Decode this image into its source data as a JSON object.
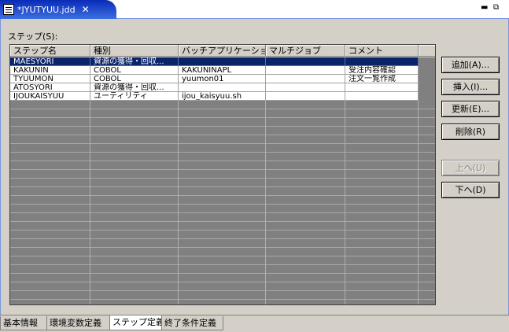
{
  "editor": {
    "tab_title": "*JYUTYUU.jdd",
    "close_symbol": "✕",
    "minimize_symbol": "▬",
    "restore_symbol": "⧉"
  },
  "steps_label": "ステップ(S):",
  "table": {
    "columns": [
      "ステップ名",
      "種別",
      "バッチアプリケーショ..",
      "マルチジョブ",
      "コメント"
    ],
    "rows": [
      {
        "name": "MAESYORI",
        "type": "資源の獲得・回収...",
        "app": "",
        "multi": "",
        "comment": ""
      },
      {
        "name": "KAKUNIN",
        "type": "COBOL",
        "app": "KAKUNINAPL",
        "multi": "",
        "comment": "受注内容確認"
      },
      {
        "name": "TYUUMON",
        "type": "COBOL",
        "app": "yuumon01",
        "multi": "",
        "comment": "注文一覧作成"
      },
      {
        "name": "ATOSYORI",
        "type": "資源の獲得・回収...",
        "app": "",
        "multi": "",
        "comment": ""
      },
      {
        "name": "IJOUKAISYUU",
        "type": "ユーティリティ",
        "app": "ijou_kaisyuu.sh",
        "multi": "",
        "comment": ""
      }
    ],
    "selected_row": 0
  },
  "buttons": {
    "add": "追加(A)...",
    "insert": "挿入(I)...",
    "update": "更新(E)...",
    "delete": "削除(R)",
    "up": "上へ(U)",
    "down": "下へ(D)"
  },
  "bottom_tabs": [
    "基本情報",
    "環境変数定義",
    "ステップ定義",
    "終了条件定義"
  ],
  "active_bottom_tab": 2,
  "colors": {
    "selection": "#0a246a",
    "tab_active": "#0a2bb8"
  }
}
